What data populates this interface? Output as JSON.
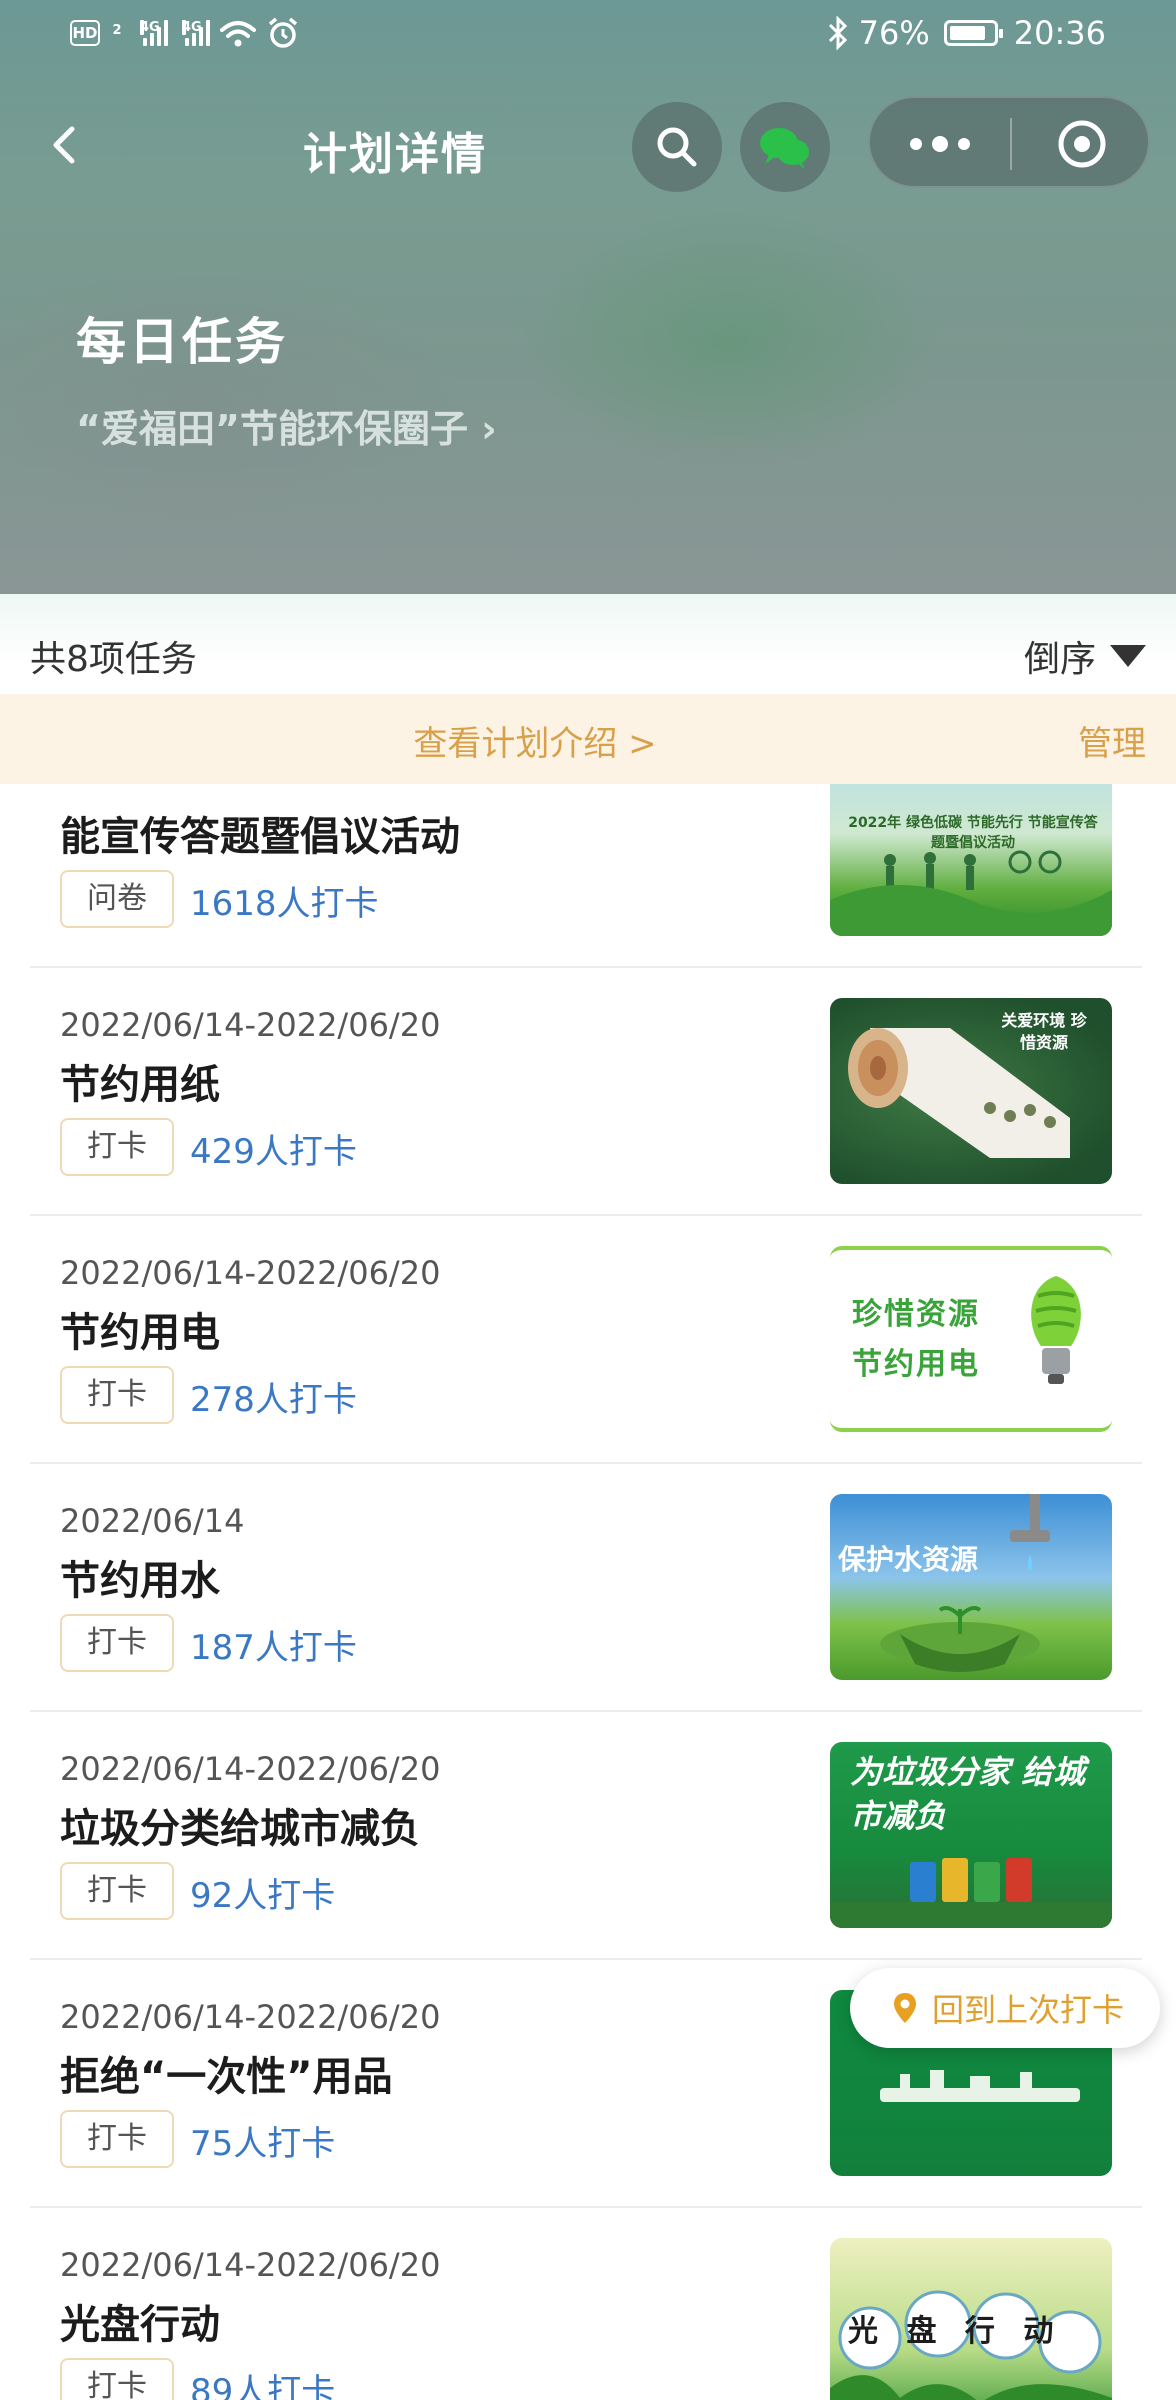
{
  "status_bar": {
    "network": "4G",
    "hd": "HD",
    "sim": "2",
    "battery": "76%",
    "time": "20:36"
  },
  "nav": {
    "title": "计划详情"
  },
  "plan": {
    "title": "每日任务",
    "circle": "“爱福田”节能环保圈子 ›"
  },
  "summary": {
    "count": "共8项任务",
    "order": "倒序"
  },
  "intro": {
    "link": "查看计划介绍 >",
    "manage": "管理"
  },
  "tasks": [
    {
      "date": "",
      "title": "能宣传答题暨倡议活动",
      "tag": "问卷",
      "stat": "1618人打卡",
      "thumb_text": "2022年 绿色低碳 节能先行 节能宣传答题暨倡议活动"
    },
    {
      "date": "2022/06/14-2022/06/20",
      "title": "节约用纸",
      "tag": "打卡",
      "stat": "429人打卡",
      "thumb_text": "关爱环境 珍惜资源"
    },
    {
      "date": "2022/06/14-2022/06/20",
      "title": "节约用电",
      "tag": "打卡",
      "stat": "278人打卡",
      "thumb_text": "珍惜资源 节约用电"
    },
    {
      "date": "2022/06/14",
      "title": "节约用水",
      "tag": "打卡",
      "stat": "187人打卡",
      "thumb_text": "保护水资源"
    },
    {
      "date": "2022/06/14-2022/06/20",
      "title": "垃圾分类给城市减负",
      "tag": "打卡",
      "stat": "92人打卡",
      "thumb_text": "为垃圾分家 给城市减负"
    },
    {
      "date": "2022/06/14-2022/06/20",
      "title": "拒绝“一次性”用品",
      "tag": "打卡",
      "stat": "75人打卡",
      "thumb_text": ""
    },
    {
      "date": "2022/06/14-2022/06/20",
      "title": "光盘行动",
      "tag": "打卡",
      "stat": "89人打卡",
      "thumb_text": "光 盘 行 动"
    }
  ],
  "float_button": {
    "label": "回到上次打卡"
  },
  "colors": {
    "accent": "#d9a04a",
    "link": "#3b78c4",
    "header": "#789c91"
  }
}
